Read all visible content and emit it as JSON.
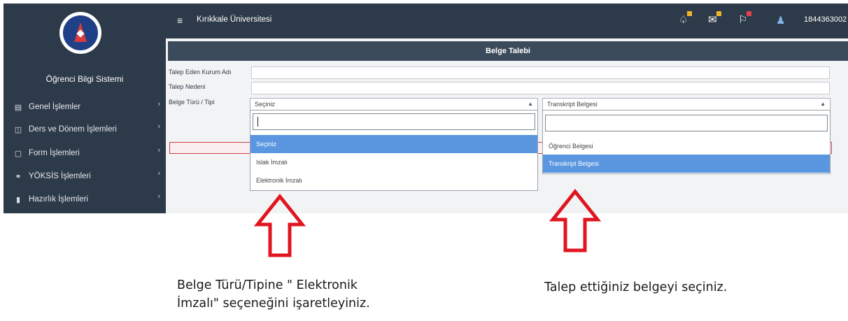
{
  "sidebar": {
    "system_title": "Öğrenci Bilgi Sistemi",
    "items": [
      {
        "label": "Genel İşlemler",
        "icon": "id-card-icon",
        "glyph": "▤"
      },
      {
        "label": "Ders ve Dönem İşlemleri",
        "icon": "book-icon",
        "glyph": "◫"
      },
      {
        "label": "Form İşlemleri",
        "icon": "document-icon",
        "glyph": "▢"
      },
      {
        "label": "YÖKSİS İşlemleri",
        "icon": "users-icon",
        "glyph": "⚭"
      },
      {
        "label": "Hazırlık İşlemleri",
        "icon": "book-open-icon",
        "glyph": "▮"
      }
    ]
  },
  "topbar": {
    "menu_icon": "hamburger-icon",
    "university": "Kırıkkale Üniversitesi",
    "user_id": "1844363002",
    "icons": [
      "bell-icon",
      "envelope-icon",
      "flag-icon"
    ],
    "badge_colors": [
      "#f0b429",
      "#f0b429",
      "#e0404a"
    ]
  },
  "panel": {
    "title": "Belge Talebi",
    "labels": {
      "institution": "Talep Eden Kurum Adı",
      "reason": "Talep Nedeni",
      "doc_type": "Belge Türü / Tipi"
    }
  },
  "select_type": {
    "value": "Seçiniz",
    "options": [
      "Seçiniz",
      "Islak İmzalı",
      "Elektronik İmzalı"
    ],
    "highlighted": "Seçiniz"
  },
  "select_doc": {
    "value": "Transkript Belgesi",
    "options": [
      "Öğrenci Belgesi",
      "Transkript Belgesi"
    ],
    "highlighted": "Transkript Belgesi"
  },
  "instructions": {
    "left_line1": "Belge Türü/Tipine \" Elektronik",
    "left_line2": "İmzalı\" seçeneğini işaretleyiniz.",
    "right": "Talep ettiğiniz belgeyi seçiniz."
  },
  "colors": {
    "sidebar": "#2d3a49",
    "panel_header": "#3c4b5c",
    "highlight": "#5a97e0",
    "arrow": "#e0151f"
  }
}
